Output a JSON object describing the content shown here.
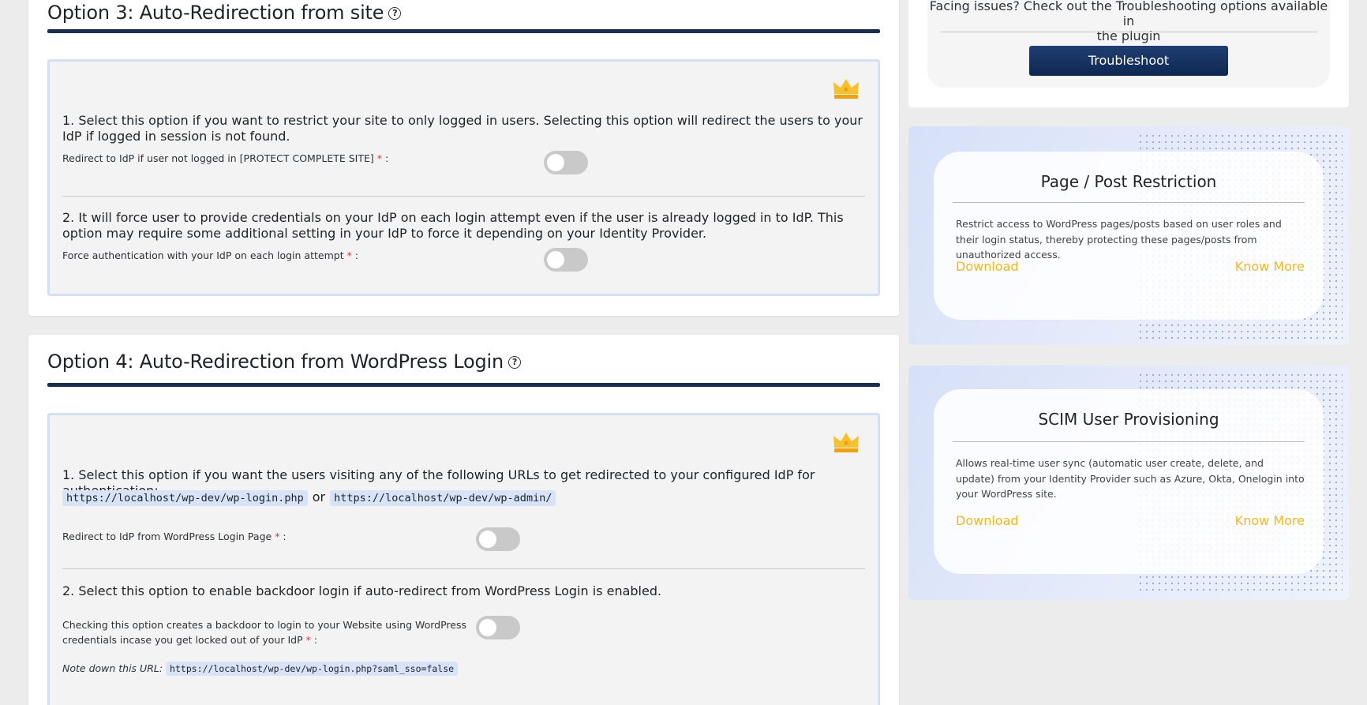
{
  "option3": {
    "title": "Option 3: Auto-Redirection from site",
    "help_icon": "?",
    "icon": "crown-icon",
    "item1_text": "1. Select this option if you want to restrict your site to only logged in users. Selecting this option will redirect the users to your IdP if logged in session is not found.",
    "item1_label": "Redirect to IdP if user not logged in [PROTECT COMPLETE SITE]",
    "item2_text": "2. It will force user to provide credentials on your IdP on each login attempt even if the user is already logged in to IdP. This option may require some additional setting in your IdP to force it depending on your Identity Provider.",
    "item2_label": "Force authentication with your IdP on each login attempt",
    "required_mark": "*",
    "label_suffix": " :"
  },
  "option4": {
    "title": "Option 4: Auto-Redirection from WordPress Login",
    "help_icon": "?",
    "icon": "crown-icon",
    "item1_text": "1. Select this option if you want the users visiting any of the following URLs to get redirected to your configured IdP for authentication:",
    "url1": "https://localhost/wp-dev/wp-login.php",
    "or": "or",
    "url2": "https://localhost/wp-dev/wp-admin/",
    "item1_label": "Redirect to IdP from WordPress Login Page",
    "item2_text": "2. Select this option to enable backdoor login if auto-redirect from WordPress Login is enabled.",
    "item2_label_line1": "Checking this option creates a backdoor to login to your Website using WordPress",
    "item2_label_line2": "credentials incase you get locked out of your IdP",
    "note_label": "Note down this URL:",
    "note_url": "https://localhost/wp-dev/wp-login.php?saml_sso=false",
    "required_mark": "*",
    "label_suffix": " :"
  },
  "troubleshoot": {
    "text_line1": "Facing issues? Check out the Troubleshooting options available in",
    "text_line2": "the plugin",
    "button": "Troubleshoot"
  },
  "promos": [
    {
      "title": "Page / Post Restriction",
      "description": "Restrict access to WordPress pages/posts based on user roles and their login status, thereby protecting these pages/posts from unauthorized access.",
      "download": "Download",
      "know_more": "Know More"
    },
    {
      "title": "SCIM User Provisioning",
      "description": "Allows real-time user sync (automatic user create, delete, and update) from your Identity Provider such as Azure, Okta, Onelogin into your WordPress site.",
      "download": "Download",
      "know_more": "Know More"
    }
  ],
  "colors": {
    "title_rule": "#1c2d55",
    "box_border": "#d3e0f7",
    "link": "#f7b718",
    "button": "#0e2852",
    "toggle_off": "#c9c9c9",
    "required": "#d63638"
  }
}
